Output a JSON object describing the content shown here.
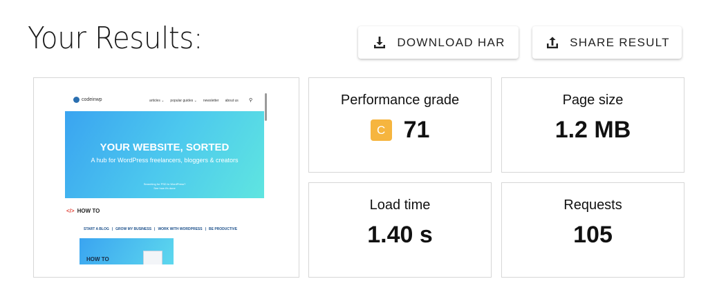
{
  "header": {
    "title": "Your Results:"
  },
  "actions": {
    "download_label": "DOWNLOAD HAR",
    "share_label": "SHARE RESULT"
  },
  "preview": {
    "site_name": "codeinwp",
    "nav": [
      "articles ⌄",
      "popular guides ⌄",
      "newsletter",
      "about us"
    ],
    "hero_title": "YOUR WEBSITE, SORTED",
    "hero_subtitle": "A hub for WordPress freelancers, bloggers & creators",
    "hero_small_1": "Searching for PSD to WordPress?",
    "hero_small_2": "See how it's done",
    "section_code": "</>",
    "section_title": "HOW TO",
    "links": [
      "START A BLOG",
      "GROW MY BUSINESS",
      "WORK WITH WORDPRESS",
      "BE PRODUCTIVE"
    ],
    "block_text": "HOW TO"
  },
  "metrics": {
    "performance": {
      "label": "Performance grade",
      "grade": "C",
      "score": "71"
    },
    "page_size": {
      "label": "Page size",
      "value": "1.2 MB"
    },
    "load_time": {
      "label": "Load time",
      "value": "1.40 s"
    },
    "requests": {
      "label": "Requests",
      "value": "105"
    }
  },
  "colors": {
    "grade_badge": "#f6b53f",
    "card_border": "#d6d6d6",
    "hero_gradient_start": "#3aa4f0",
    "hero_gradient_end": "#5fe5e0"
  },
  "icons": {
    "download": "download-icon",
    "share": "share-icon"
  }
}
